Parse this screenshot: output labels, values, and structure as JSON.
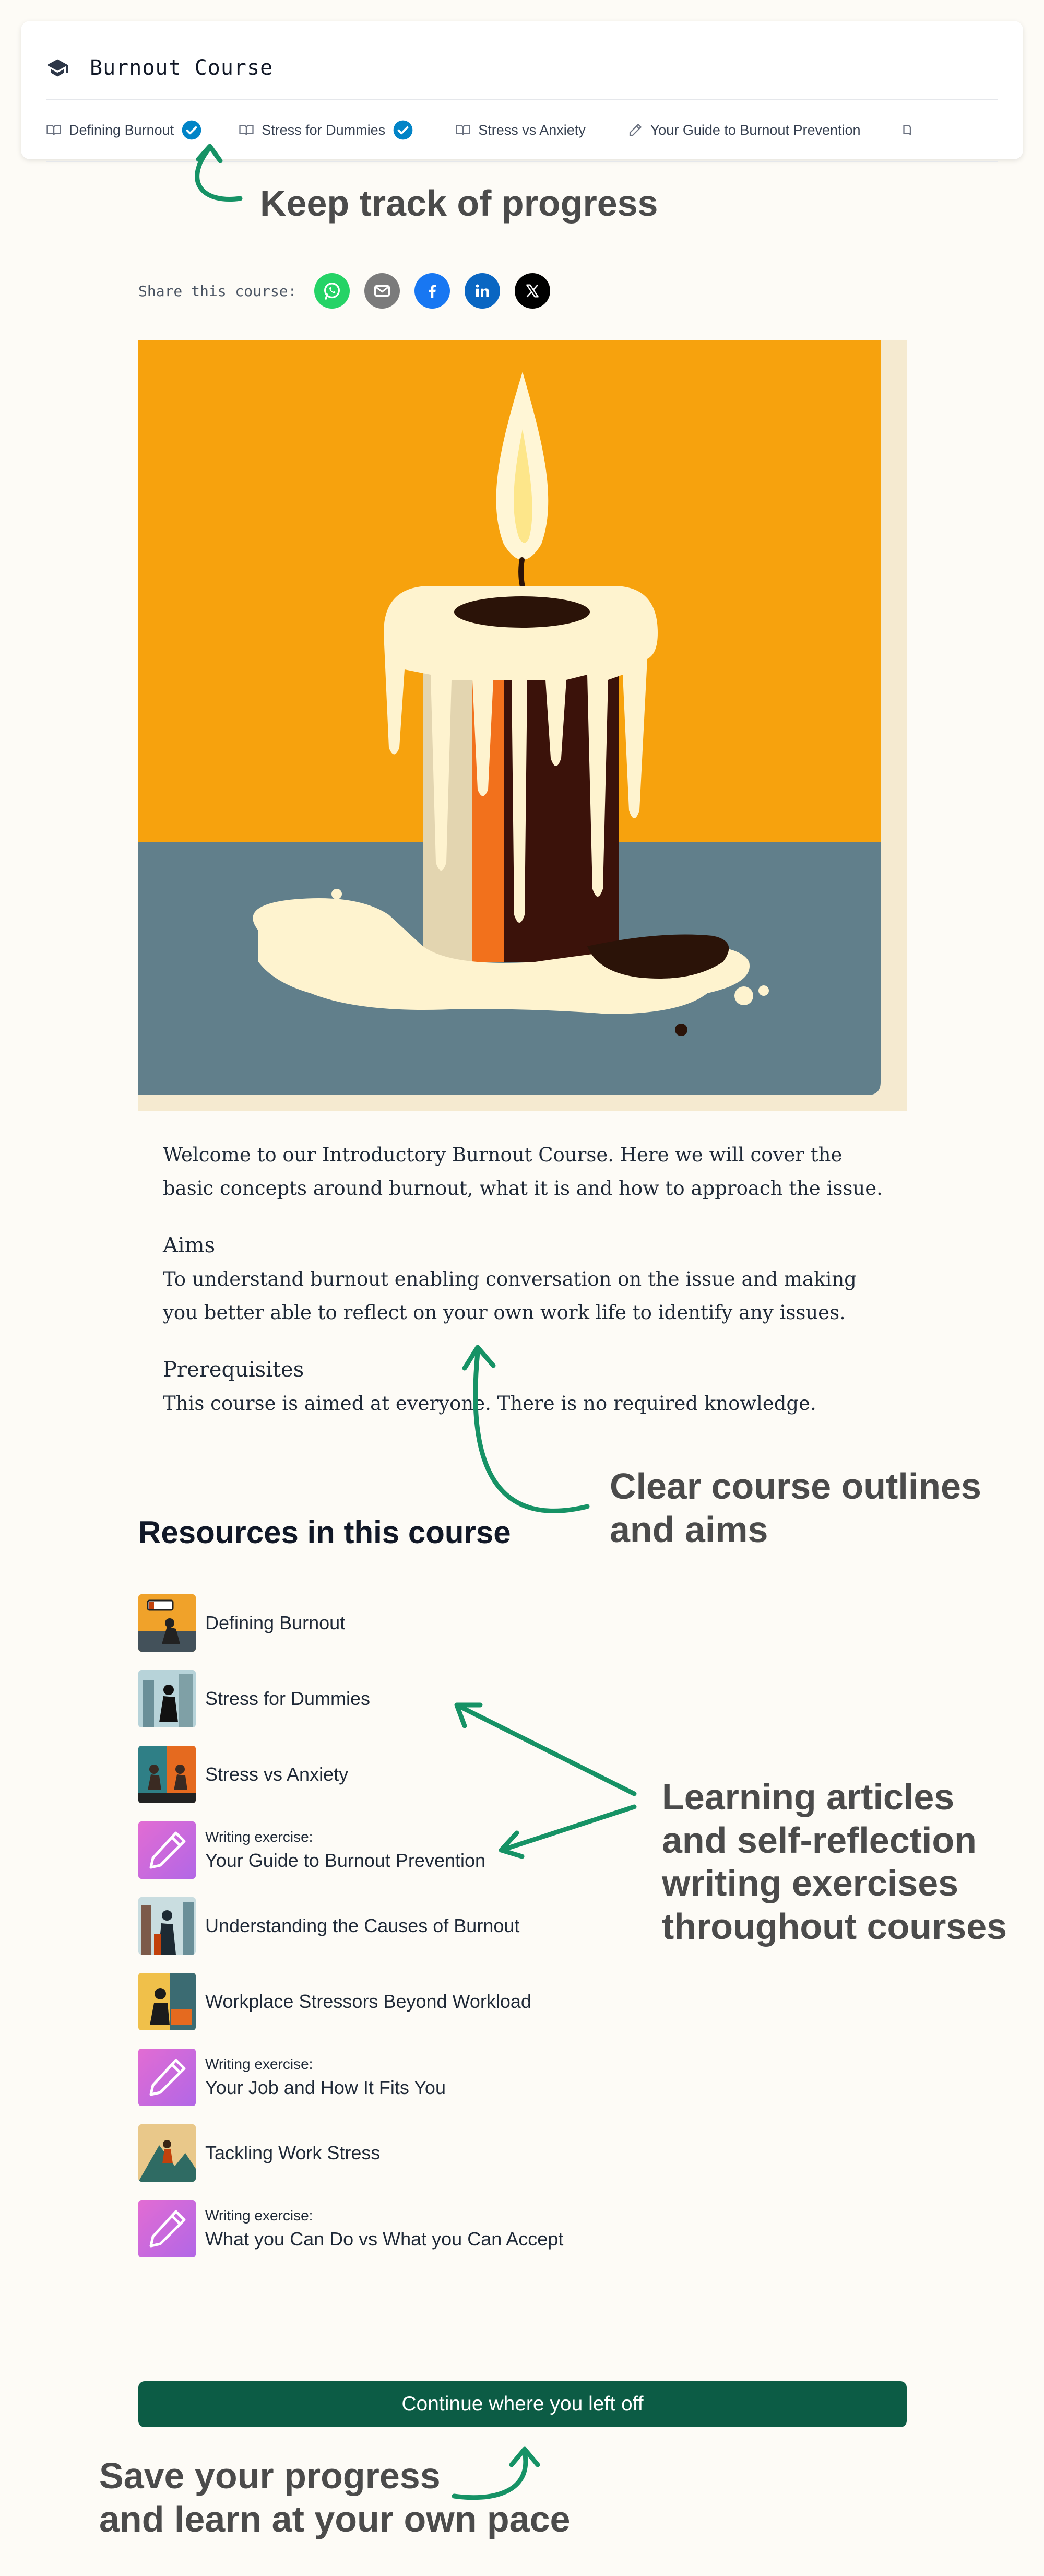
{
  "header": {
    "course_title": "Burnout Course",
    "tabs": [
      {
        "label": "Defining Burnout",
        "icon": "book-icon",
        "completed": true
      },
      {
        "label": "Stress for Dummies",
        "icon": "book-icon",
        "completed": true
      },
      {
        "label": "Stress vs Anxiety",
        "icon": "book-icon",
        "completed": false
      },
      {
        "label": "Your Guide to Burnout Prevention",
        "icon": "pencil-icon",
        "completed": false
      }
    ]
  },
  "annotations": {
    "progress": "Keep track of progress",
    "outline_line1": "Clear course outlines",
    "outline_line2": "and aims",
    "learning_line1": "Learning articles",
    "learning_line2": "and self-reflection",
    "learning_line3": "writing exercises",
    "learning_line4": "throughout courses",
    "save_line1": "Save your progress",
    "save_line2": "and learn at your own pace"
  },
  "share": {
    "label": "Share this course:",
    "buttons": [
      {
        "name": "whatsapp-icon",
        "color": "#25d366"
      },
      {
        "name": "email-icon",
        "color": "#7b7b7b"
      },
      {
        "name": "facebook-icon",
        "color": "#1877f2"
      },
      {
        "name": "linkedin-icon",
        "color": "#0a66c2"
      },
      {
        "name": "x-icon",
        "color": "#000000"
      }
    ]
  },
  "content": {
    "intro": "Welcome to our Introductory Burnout Course. Here we will cover the basic concepts around burnout, what it is and how to approach the issue.",
    "aims_heading": "Aims",
    "aims_text": "To understand burnout enabling conversation on the issue and making you better able to reflect on your own work life to identify any issues.",
    "prereq_heading": "Prerequisites",
    "prereq_text": "This course is aimed at everyone. There is no required knowledge."
  },
  "resources": {
    "title": "Resources in this course",
    "writing_kicker": "Writing exercise:",
    "items": [
      {
        "label": "Defining Burnout",
        "type": "article"
      },
      {
        "label": "Stress for Dummies",
        "type": "article"
      },
      {
        "label": "Stress vs Anxiety",
        "type": "article"
      },
      {
        "label": "Your Guide to Burnout Prevention",
        "type": "writing"
      },
      {
        "label": "Understanding the Causes of Burnout",
        "type": "article"
      },
      {
        "label": "Workplace Stressors Beyond Workload",
        "type": "article"
      },
      {
        "label": "Your Job and How It Fits You",
        "type": "writing"
      },
      {
        "label": "Tackling Work Stress",
        "type": "article"
      },
      {
        "label": "What you Can Do vs What you Can Accept",
        "type": "writing"
      }
    ]
  },
  "cta": {
    "continue_label": "Continue where you left off"
  },
  "colors": {
    "accent": "#0c5c45",
    "annotation_green": "#169265",
    "check_blue": "#0284c7"
  }
}
